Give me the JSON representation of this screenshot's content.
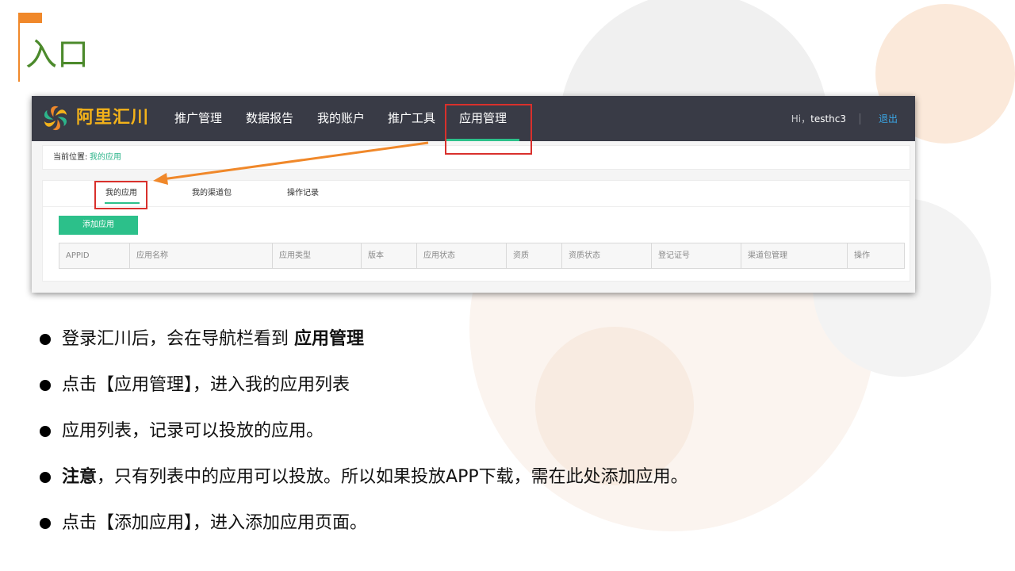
{
  "slide": {
    "title": "入口"
  },
  "screenshot": {
    "brand": "阿里汇川",
    "nav": [
      "推广管理",
      "数据报告",
      "我的账户",
      "推广工具",
      "应用管理"
    ],
    "greeting_prefix": "Hi，",
    "username": "testhc3",
    "logout": "退出",
    "breadcrumb_label": "当前位置:",
    "breadcrumb_link": "我的应用",
    "tabs": [
      "我的应用",
      "我的渠道包",
      "操作记录"
    ],
    "add_button": "添加应用",
    "columns": [
      "APPID",
      "应用名称",
      "应用类型",
      "版本",
      "应用状态",
      "资质",
      "资质状态",
      "登记证号",
      "渠道包管理",
      "操作"
    ]
  },
  "bullets": [
    {
      "text": "登录汇川后，会在导航栏看到 ",
      "bold": "应用管理"
    },
    {
      "text": "点击【应用管理】，进入我的应用列表"
    },
    {
      "text": "应用列表，记录可以投放的应用。"
    },
    {
      "bold_lead": "注意",
      "text": "，只有列表中的应用可以投放。所以如果投放APP下载，需在此处添加应用。"
    },
    {
      "text": "点击【添加应用】，进入添加应用页面。"
    }
  ],
  "colors": {
    "accent_orange": "#f0882a",
    "title_green": "#4c8a2c",
    "nav_bg": "#393b46",
    "brand_yellow": "#f3b21a",
    "active_green": "#2cc08a",
    "highlight_red": "#d9302c"
  }
}
